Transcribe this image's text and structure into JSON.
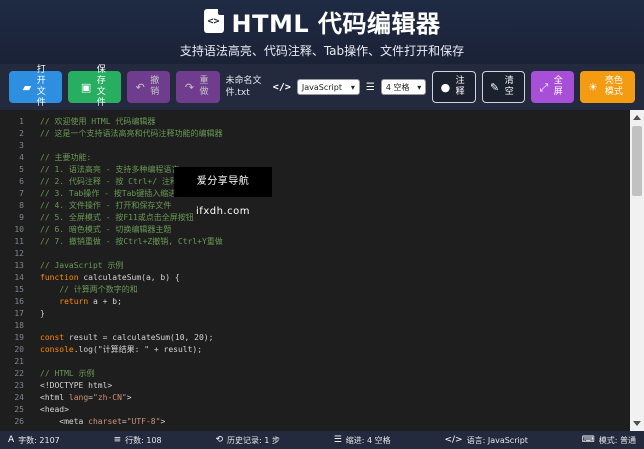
{
  "header": {
    "title": "HTML 代码编辑器",
    "icon_glyph": "<>",
    "subtitle": "支持语法高亮、代码注释、Tab操作、文件打开和保存"
  },
  "toolbar": {
    "open_label": "打开文件",
    "save_label": "保存文件",
    "undo_label": "撤销",
    "redo_label": "重做",
    "filename": "未命名文件.txt",
    "language_selected": "JavaScript",
    "indent_selected": "4 空格",
    "comment_label": "注释",
    "clear_label": "清空",
    "fullscreen_label": "全屏",
    "theme_label": "亮色模式"
  },
  "editor": {
    "line_numbers": [
      "1",
      "2",
      "3",
      "4",
      "5",
      "6",
      "7",
      "8",
      "9",
      "10",
      "11",
      "12",
      "13",
      "14",
      "15",
      "16",
      "17",
      "18",
      "19",
      "20",
      "21",
      "22",
      "23",
      "24",
      "25",
      "26"
    ],
    "lines": [
      [
        {
          "t": "// 欢迎使用 HTML 代码编辑器",
          "c": "c-com"
        }
      ],
      [
        {
          "t": "// 这是一个支持语法高亮和代码注释功能的编辑器",
          "c": "c-com"
        }
      ],
      [],
      [
        {
          "t": "// 主要功能:",
          "c": "c-com"
        }
      ],
      [
        {
          "t": "// 1. 语法高亮 - 支持多种编程语言",
          "c": "c-com"
        }
      ],
      [
        {
          "t": "// 2. 代码注释 - 按 Ctrl+/ 注释/取消注释",
          "c": "c-com"
        }
      ],
      [
        {
          "t": "// 3. Tab操作 - 按Tab键插入缩进",
          "c": "c-com"
        }
      ],
      [
        {
          "t": "// 4. 文件操作 - 打开和保存文件",
          "c": "c-com"
        }
      ],
      [
        {
          "t": "// 5. 全屏模式 - 按F11或点击全屏按钮",
          "c": "c-com"
        }
      ],
      [
        {
          "t": "// 6. 暗色模式 - 切换编辑器主题",
          "c": "c-com"
        }
      ],
      [
        {
          "t": "// 7. 撤销重做 - 按Ctrl+Z撤销, Ctrl+Y重做",
          "c": "c-com"
        }
      ],
      [],
      [
        {
          "t": "// JavaScript 示例",
          "c": "c-com"
        }
      ],
      [
        {
          "t": "function",
          "c": "c-kw"
        },
        {
          "t": " calculateSum(a, b) {",
          "c": "c-txt"
        }
      ],
      [
        {
          "t": "    // 计算两个数字的和",
          "c": "c-com"
        }
      ],
      [
        {
          "t": "    ",
          "c": "c-txt"
        },
        {
          "t": "return",
          "c": "c-kw"
        },
        {
          "t": " a + b;",
          "c": "c-txt"
        }
      ],
      [
        {
          "t": "}",
          "c": "c-txt"
        }
      ],
      [],
      [
        {
          "t": "const",
          "c": "c-kw"
        },
        {
          "t": " result = calculateSum(10, 20);",
          "c": "c-txt"
        }
      ],
      [
        {
          "t": "console",
          "c": "c-kw"
        },
        {
          "t": ".log(",
          "c": "c-txt"
        },
        {
          "t": "\"计算结果: \"",
          "c": "c-txt"
        },
        {
          "t": " + result);",
          "c": "c-txt"
        }
      ],
      [],
      [
        {
          "t": "// HTML 示例",
          "c": "c-com"
        }
      ],
      [
        {
          "t": "<!DOCTYPE html>",
          "c": "c-txt"
        }
      ],
      [
        {
          "t": "<html ",
          "c": "c-txt"
        },
        {
          "t": "lang",
          "c": "c-str"
        },
        {
          "t": "=",
          "c": "c-txt"
        },
        {
          "t": "\"zh-CN\"",
          "c": "c-str"
        },
        {
          "t": ">",
          "c": "c-txt"
        }
      ],
      [
        {
          "t": "<head>",
          "c": "c-txt"
        }
      ],
      [
        {
          "t": "    <meta ",
          "c": "c-txt"
        },
        {
          "t": "charset",
          "c": "c-str"
        },
        {
          "t": "=",
          "c": "c-txt"
        },
        {
          "t": "\"UTF-8\"",
          "c": "c-str"
        },
        {
          "t": ">",
          "c": "c-txt"
        }
      ]
    ]
  },
  "watermark": "爱分享导航 ifxdh.com",
  "status": {
    "chars": "字数: 2107",
    "lines": "行数: 108",
    "history": "历史记录: 1 步",
    "indent": "缩进: 4 空格",
    "language": "语言: JavaScript",
    "mode": "模式: 普通"
  },
  "colors": {
    "open": "#2e8ee0",
    "save": "#27ae60",
    "undo_redo": "#8e44ad",
    "fullscreen": "#a84fd8",
    "theme": "#f39c12",
    "comment": "#6a9955",
    "keyword": "#ff8c00"
  },
  "icons": {
    "open": "folder-open-icon",
    "save": "save-icon",
    "undo": "undo-icon",
    "redo": "redo-icon",
    "code": "code-icon",
    "indent": "indent-icon",
    "comment": "comment-icon",
    "clear": "broom-icon",
    "fullscreen": "expand-icon",
    "theme": "sun-icon"
  }
}
